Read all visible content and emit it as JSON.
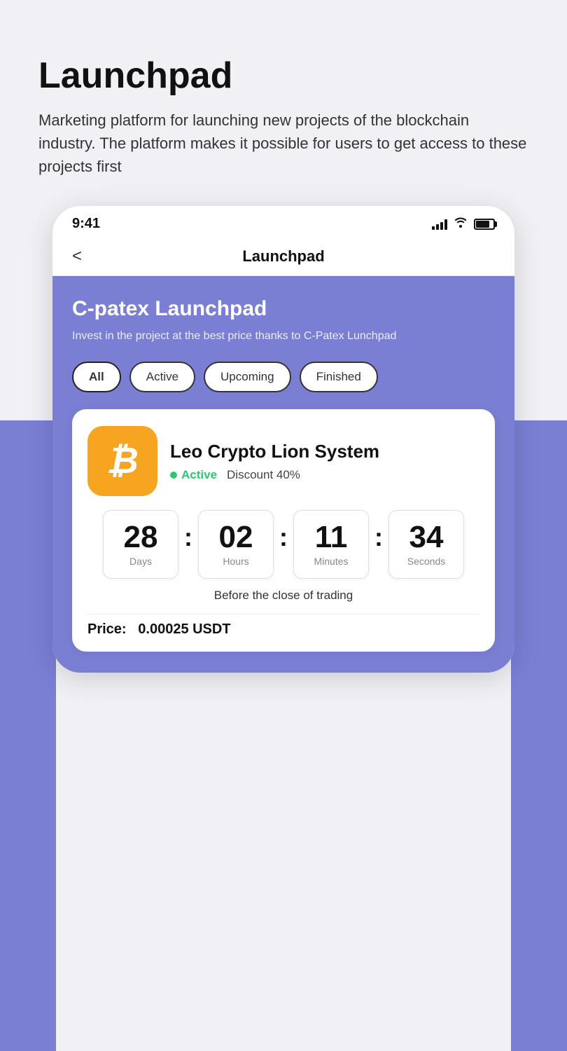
{
  "page": {
    "title": "Launchpad",
    "description": "Marketing platform for launching new projects of the blockchain industry. The platform makes it possible for users to get access to these projects first"
  },
  "statusBar": {
    "time": "9:41",
    "signal": "signal",
    "wifi": "wifi",
    "battery": "battery"
  },
  "navBar": {
    "back_label": "<",
    "title": "Launchpad"
  },
  "content": {
    "section_title": "C-patex Launchpad",
    "section_subtitle": "Invest in the project at the best price thanks to C-Patex Lunchpad"
  },
  "filters": {
    "all_label": "All",
    "active_label": "Active",
    "upcoming_label": "Upcoming",
    "finished_label": "Finished"
  },
  "project": {
    "name": "Leo Crypto Lion System",
    "status": "Active",
    "discount": "Discount 40%",
    "countdown": {
      "days_value": "28",
      "days_label": "Days",
      "hours_value": "02",
      "hours_label": "Hours",
      "minutes_value": "11",
      "minutes_label": "Minutes",
      "seconds_value": "34",
      "seconds_label": "Seconds",
      "caption": "Before the close of trading"
    },
    "price_label": "Price:",
    "price_value": "0.00025 USDT"
  }
}
